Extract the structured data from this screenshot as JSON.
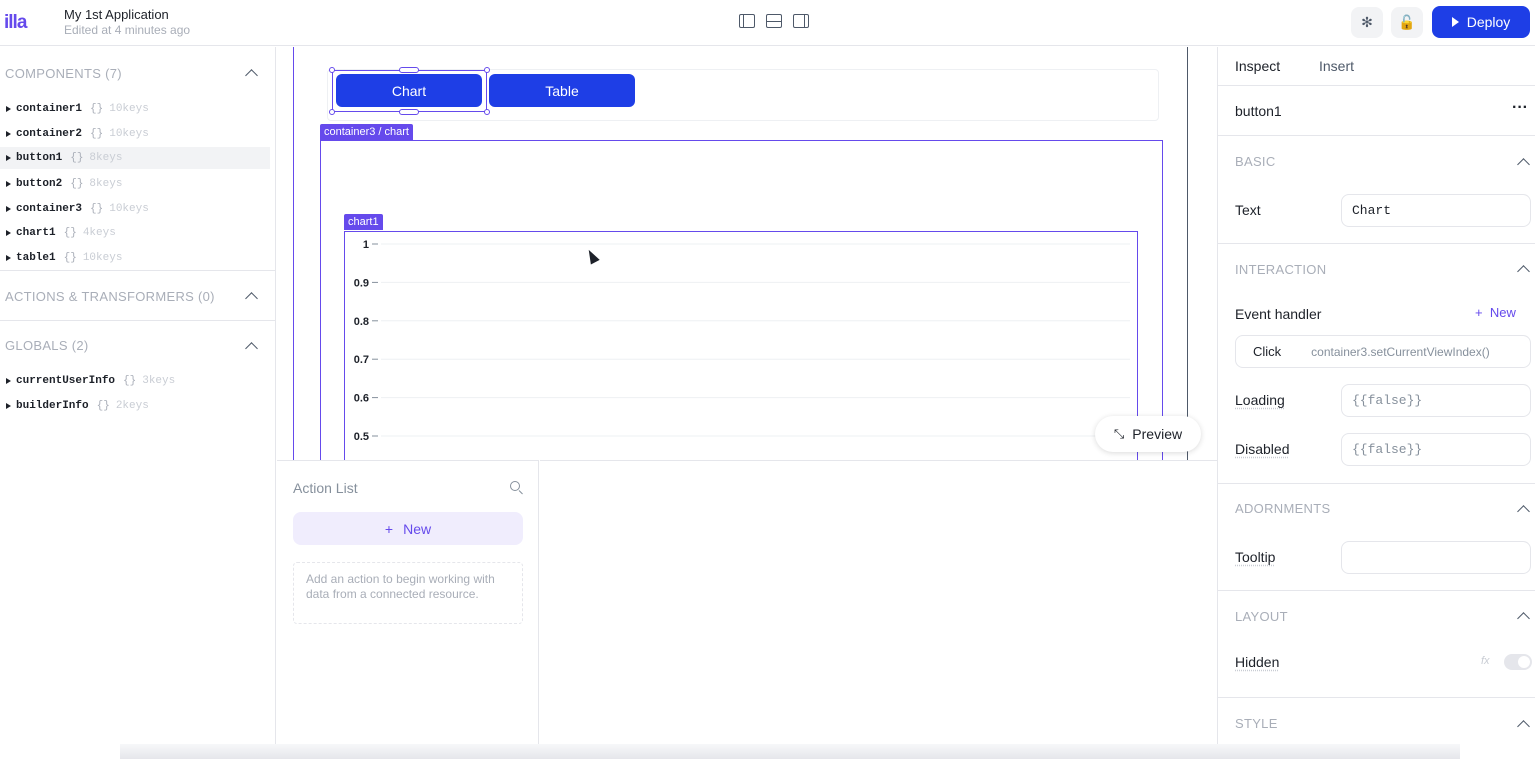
{
  "header": {
    "logo": "illa",
    "app_title": "My 1st Application",
    "edited": "Edited at 4 minutes ago",
    "deploy_label": "Deploy"
  },
  "left": {
    "components_title": "COMPONENTS (7)",
    "components": [
      {
        "name": "container1",
        "braces": "{}",
        "keys": "10keys"
      },
      {
        "name": "container2",
        "braces": "{}",
        "keys": "10keys"
      },
      {
        "name": "button1",
        "braces": "{}",
        "keys": "8keys"
      },
      {
        "name": "button2",
        "braces": "{}",
        "keys": "8keys"
      },
      {
        "name": "container3",
        "braces": "{}",
        "keys": "10keys"
      },
      {
        "name": "chart1",
        "braces": "{}",
        "keys": "4keys"
      },
      {
        "name": "table1",
        "braces": "{}",
        "keys": "10keys"
      }
    ],
    "actions_title": "ACTIONS & TRANSFORMERS (0)",
    "globals_title": "GLOBALS (2)",
    "globals": [
      {
        "name": "currentUserInfo",
        "braces": "{}",
        "keys": "3keys"
      },
      {
        "name": "builderInfo",
        "braces": "{}",
        "keys": "2keys"
      }
    ]
  },
  "canvas": {
    "button_chart": "Chart",
    "button_table": "Table",
    "container_tag": "container3 / chart",
    "chart_tag": "chart1",
    "preview_label": "Preview"
  },
  "chart_data": {
    "type": "line",
    "series": [],
    "ylim": [
      0.5,
      1
    ],
    "y_ticks": [
      "1",
      "0.9",
      "0.8",
      "0.7",
      "0.6",
      "0.5"
    ],
    "grid": true
  },
  "action_list": {
    "title": "Action List",
    "new_label": "New",
    "empty_text": "Add an action to begin working with data from a connected resource."
  },
  "inspector": {
    "tab_inspect": "Inspect",
    "tab_insert": "Insert",
    "component_name": "button1",
    "more": "···",
    "basic_title": "BASIC",
    "text_label": "Text",
    "text_value": "Chart",
    "interaction_title": "INTERACTION",
    "event_handler_label": "Event handler",
    "new_label": "New",
    "event_name": "Click",
    "event_method": "container3.setCurrentViewIndex()",
    "loading_label": "Loading",
    "loading_value": "{{false}}",
    "disabled_label": "Disabled",
    "disabled_value": "{{false}}",
    "adornments_title": "ADORNMENTS",
    "tooltip_label": "Tooltip",
    "tooltip_value": "",
    "layout_title": "LAYOUT",
    "hidden_label": "Hidden",
    "fx_label": "fx",
    "style_title": "STYLE"
  },
  "colors": {
    "primary": "#1e3ee6",
    "accent": "#654aec"
  }
}
